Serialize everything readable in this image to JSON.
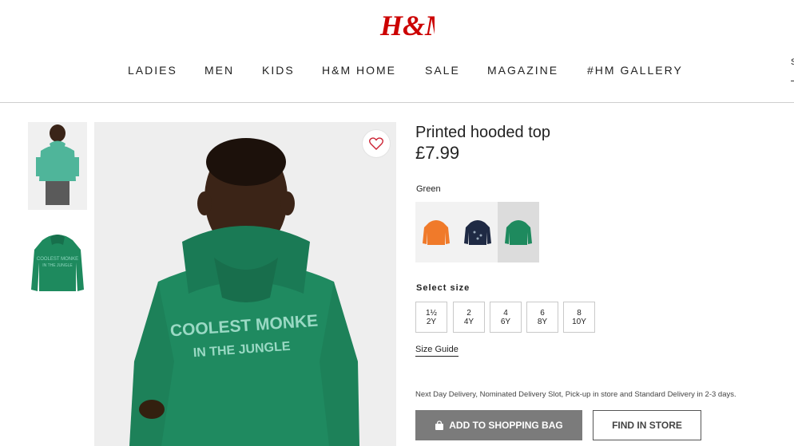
{
  "brand": {
    "logo_text": "H&M",
    "logo_color": "#cc0000"
  },
  "nav": {
    "items": [
      {
        "label": "LADIES"
      },
      {
        "label": "MEN"
      },
      {
        "label": "KIDS"
      },
      {
        "label": "H&M HOME"
      },
      {
        "label": "SALE"
      },
      {
        "label": "MAGAZINE"
      },
      {
        "label": "#HM GALLERY"
      }
    ],
    "right_partial": "S"
  },
  "product": {
    "title": "Printed hooded top",
    "price": "£7.99",
    "hoodie_print_line1": "COOLEST MONKE",
    "hoodie_print_line2": "IN THE JUNGLE",
    "color_label": "Green",
    "swatches": [
      {
        "name": "orange",
        "color": "#f07a2a",
        "selected": false
      },
      {
        "name": "navy",
        "color": "#1f2a44",
        "selected": false
      },
      {
        "name": "green",
        "color": "#1e8a5e",
        "selected": true
      }
    ],
    "size_label": "Select size",
    "sizes": [
      {
        "line1": "1½",
        "line2": "2Y"
      },
      {
        "line1": "2",
        "line2": "4Y"
      },
      {
        "line1": "4",
        "line2": "6Y"
      },
      {
        "line1": "6",
        "line2": "8Y"
      },
      {
        "line1": "8",
        "line2": "10Y"
      }
    ],
    "size_guide": "Size Guide",
    "delivery_text": "Next Day Delivery, Nominated Delivery Slot, Pick-up in store and Standard Delivery in 2-3 days.",
    "add_to_bag": "ADD TO SHOPPING BAG",
    "find_in_store": "FIND IN STORE"
  }
}
